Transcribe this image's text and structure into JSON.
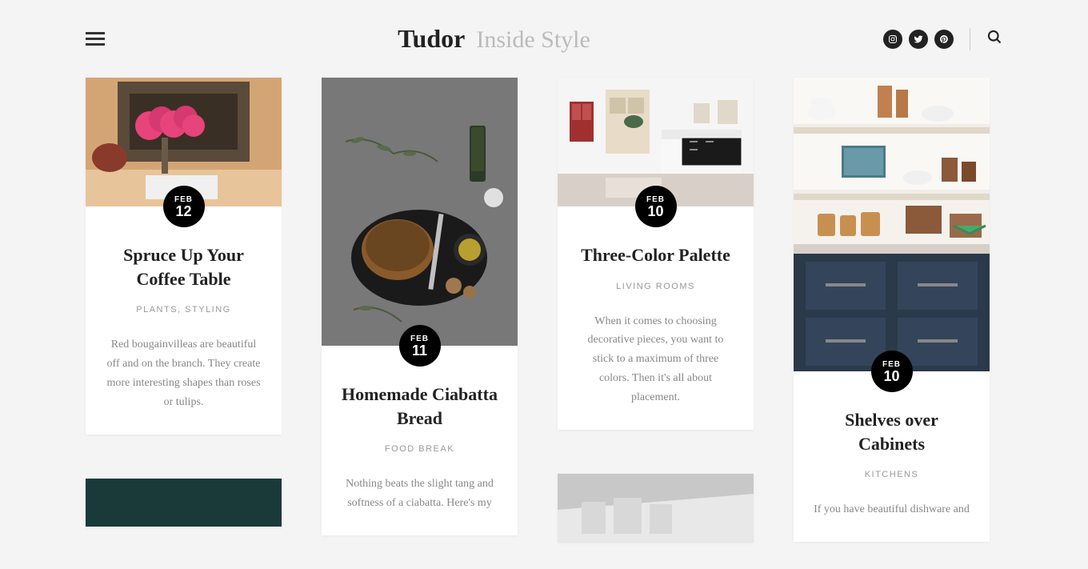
{
  "header": {
    "logo_main": "Tudor",
    "logo_sub": "Inside Style"
  },
  "posts": [
    {
      "month": "FEB",
      "day": "12",
      "title": "Spruce Up Your Coffee Table",
      "categories": [
        "PLANTS",
        "STYLING"
      ],
      "excerpt": "Red bougainvilleas are beautiful off and on the branch. They create more interesting shapes than roses or tulips."
    },
    {
      "month": "FEB",
      "day": "11",
      "title": "Homemade Ciabatta Bread",
      "categories": [
        "FOOD BREAK"
      ],
      "excerpt": "Nothing beats the slight tang and softness of a ciabatta. Here's my"
    },
    {
      "month": "FEB",
      "day": "10",
      "title": "Three-Color Palette",
      "categories": [
        "LIVING ROOMS"
      ],
      "excerpt": "When it comes to choosing decorative pieces, you want to stick to a maximum of three colors. Then it's all about placement."
    },
    {
      "month": "FEB",
      "day": "10",
      "title": "Shelves over Cabinets",
      "categories": [
        "KITCHENS"
      ],
      "excerpt": "If you have beautiful dishware and"
    }
  ]
}
